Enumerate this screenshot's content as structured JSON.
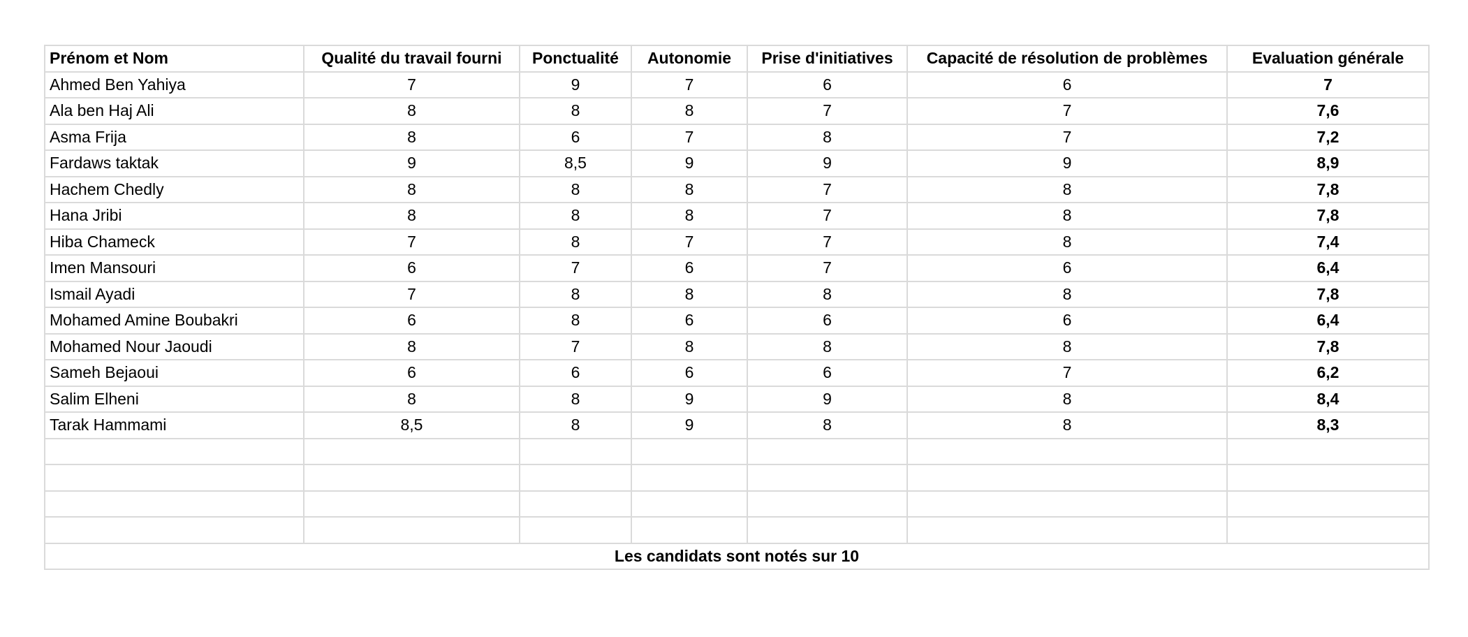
{
  "headers": [
    "Prénom et Nom",
    "Qualité du travail fourni",
    "Ponctualité",
    "Autonomie",
    "Prise d'initiatives",
    "Capacité de résolution de problèmes",
    "Evaluation générale"
  ],
  "rows": [
    [
      "Ahmed Ben Yahiya",
      "7",
      "9",
      "7",
      "6",
      "6",
      "7"
    ],
    [
      "Ala ben Haj Ali",
      "8",
      "8",
      "8",
      "7",
      "7",
      "7,6"
    ],
    [
      "Asma Frija",
      "8",
      "6",
      "7",
      "8",
      "7",
      "7,2"
    ],
    [
      "Fardaws taktak",
      "9",
      "8,5",
      "9",
      "9",
      "9",
      "8,9"
    ],
    [
      "Hachem Chedly",
      "8",
      "8",
      "8",
      "7",
      "8",
      "7,8"
    ],
    [
      "Hana Jribi",
      "8",
      "8",
      "8",
      "7",
      "8",
      "7,8"
    ],
    [
      "Hiba Chameck",
      "7",
      "8",
      "7",
      "7",
      "8",
      "7,4"
    ],
    [
      "Imen Mansouri",
      "6",
      "7",
      "6",
      "7",
      "6",
      "6,4"
    ],
    [
      "Ismail Ayadi",
      "7",
      "8",
      "8",
      "8",
      "8",
      "7,8"
    ],
    [
      "Mohamed Amine Boubakri",
      "6",
      "8",
      "6",
      "6",
      "6",
      "6,4"
    ],
    [
      "Mohamed Nour Jaoudi",
      "8",
      "7",
      "8",
      "8",
      "8",
      "7,8"
    ],
    [
      "Sameh Bejaoui",
      "6",
      "6",
      "6",
      "6",
      "7",
      "6,2"
    ],
    [
      "Salim Elheni",
      "8",
      "8",
      "9",
      "9",
      "8",
      "8,4"
    ],
    [
      "Tarak Hammami",
      "8,5",
      "8",
      "9",
      "8",
      "8",
      "8,3"
    ]
  ],
  "empty_row_count": 4,
  "footer_note": "Les candidats sont notés sur 10",
  "colors": {
    "grid": "#dadada",
    "text": "#000000",
    "background": "#ffffff"
  }
}
